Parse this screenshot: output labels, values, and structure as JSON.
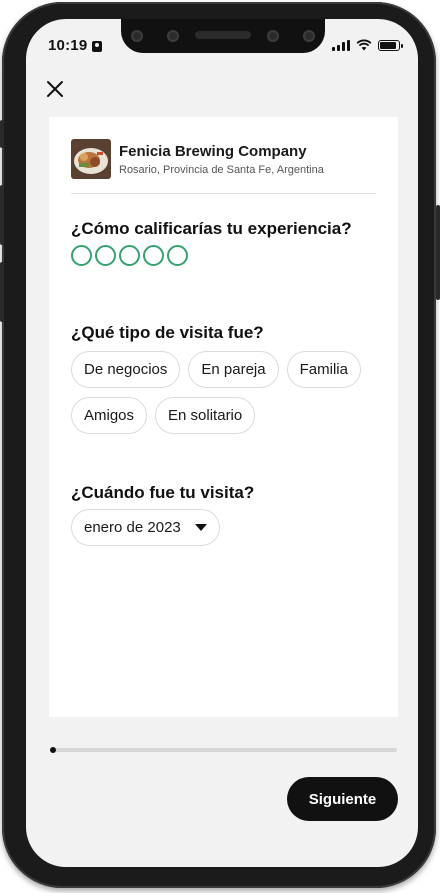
{
  "status_bar": {
    "time": "10:19"
  },
  "business": {
    "name": "Fenicia Brewing Company",
    "location": "Rosario, Provincia de Santa Fe, Argentina"
  },
  "rating_question": "¿Cómo calificarías tu experiencia?",
  "rating": {
    "value": 0,
    "max": 5
  },
  "visit_type_question": "¿Qué tipo de visita fue?",
  "visit_types": [
    "De negocios",
    "En pareja",
    "Familia",
    "Amigos",
    "En solitario"
  ],
  "visit_date_question": "¿Cuándo fue tu visita?",
  "visit_date": {
    "selected": "enero de 2023"
  },
  "progress": {
    "fraction": 0.01
  },
  "next_button": "Siguiente",
  "colors": {
    "rating_green": "#34a26f",
    "button_bg": "#111111",
    "screen_bg": "#f2f2f2"
  },
  "icons": [
    "close-icon",
    "signal-icon",
    "wifi-icon",
    "battery-icon",
    "caret-down-icon"
  ]
}
